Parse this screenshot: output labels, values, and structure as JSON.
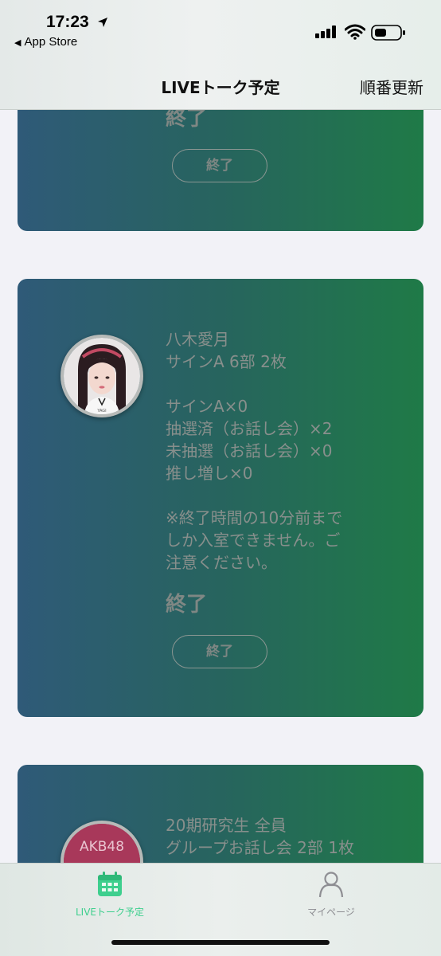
{
  "status_bar": {
    "time": "17:23",
    "back_label": "App Store",
    "icons": [
      "location-arrow-icon",
      "signal-icon",
      "wifi-icon",
      "battery-icon"
    ]
  },
  "nav": {
    "title": "LIVEトーク予定",
    "action": "順番更新"
  },
  "cards": [
    {
      "status": "終了",
      "button": "終了"
    },
    {
      "name": "八木愛月",
      "session": "サインA 6部 2枚",
      "details": [
        "サインA×0",
        "抽選済（お話し会）×2",
        "未抽選（お話し会）×0",
        "推し増し×0"
      ],
      "note": "※終了時間の10分前まで\nしか入室できません。ご\n注意ください。",
      "status": "終了",
      "button": "終了",
      "avatar_caption": "YAGI"
    },
    {
      "name": "20期研究生 全員",
      "session": "グループお話し会 2部 1枚",
      "avatar_logo": "AKB48"
    }
  ],
  "tabbar": {
    "tabs": [
      {
        "label": "LIVEトーク予定",
        "icon": "calendar-icon",
        "active": true
      },
      {
        "label": "マイページ",
        "icon": "person-icon",
        "active": false
      }
    ]
  },
  "colors": {
    "accent": "#3ecf8e",
    "card_gradient_start": "#2f5a78",
    "card_gradient_end": "#1f7a47",
    "background": "#f2f2f7"
  }
}
